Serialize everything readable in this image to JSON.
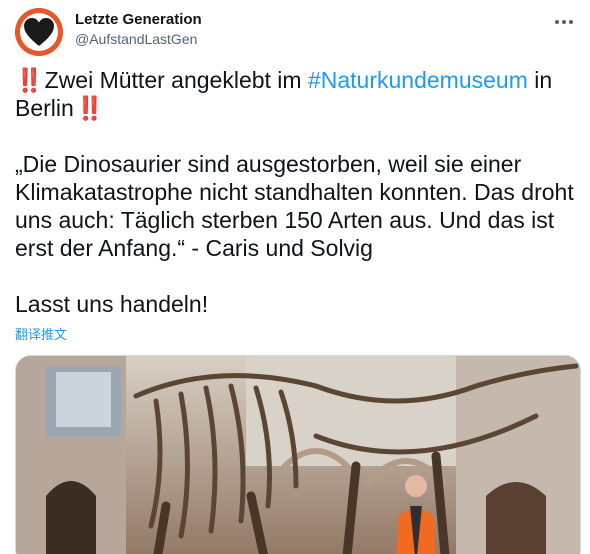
{
  "author": {
    "name": "Letzte Generation",
    "handle": "@AufstandLastGen",
    "avatar_icon": "heart-logo-icon",
    "avatar_color": "#e8572a"
  },
  "menu_icon": "more-options-icon",
  "tweet": {
    "line1_part1": "Zwei Mütter angeklebt im ",
    "hashtag": "#Naturkundemuseum",
    "line1_part2": " in Berlin",
    "emoji": "‼️",
    "quote": "„Die Dinosaurier sind ausgestorben, weil sie einer Klimakatastrophe nicht standhalten konnten. Das droht uns auch: Täglich sterben 150 Arten aus. Und das ist erst der Anfang.“ - Caris und Solvig",
    "closing": "Lasst uns handeln!"
  },
  "translate_label": "翻译推文",
  "media": {
    "icon": "photo-dinosaur-skeleton-museum"
  },
  "colors": {
    "link": "#1d9bf0",
    "text": "#0f1419",
    "secondary": "#536471",
    "emoji_red": "#d31f2a"
  }
}
